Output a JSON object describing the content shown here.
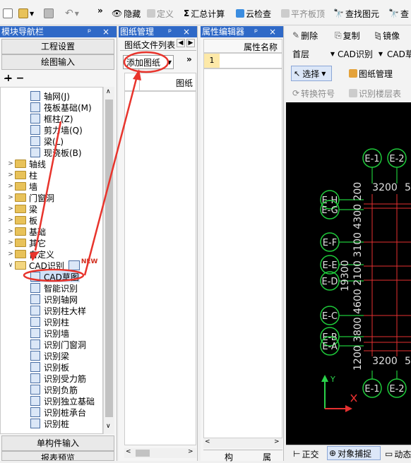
{
  "toolbar": {
    "more_glyph": "»",
    "hide": "隐藏",
    "define": "定义",
    "sum_glyph": "Σ",
    "sum": "汇总计算",
    "cloud_check": "云检查",
    "flush_slab": "平齐板顶",
    "find_element": "查找图元",
    "find_more": "查"
  },
  "module_nav": {
    "title": "模块导航栏",
    "controls": "ᵖ ×",
    "project_settings": "工程设置",
    "drawing_input": "绘图输入",
    "tree_top": [
      {
        "label": "轴网(J)",
        "icon": "grid-icon"
      },
      {
        "label": "筏板基础(M)",
        "icon": "raft-icon"
      },
      {
        "label": "框柱(Z)",
        "icon": "column-icon"
      },
      {
        "label": "剪力墙(Q)",
        "icon": "wall-icon"
      },
      {
        "label": "梁(L)",
        "icon": "beam-icon"
      },
      {
        "label": "现浇板(B)",
        "icon": "slab-icon"
      }
    ],
    "folders": [
      "轴线",
      "柱",
      "墙",
      "门窗洞",
      "梁",
      "板",
      "基础",
      "其它",
      "自定义"
    ],
    "cad_folder": "CAD识别",
    "new_badge": "NEW",
    "cad_items": [
      {
        "label": "CAD草图",
        "icon": "cad-sketch-icon"
      },
      {
        "label": "智能识别",
        "icon": "smart-recognize-icon"
      },
      {
        "label": "识别轴网",
        "icon": "recognize-grid-icon"
      },
      {
        "label": "识别柱大样",
        "icon": "recognize-column-detail-icon"
      },
      {
        "label": "识别柱",
        "icon": "recognize-column-icon"
      },
      {
        "label": "识别墙",
        "icon": "recognize-wall-icon"
      },
      {
        "label": "识别门窗洞",
        "icon": "recognize-opening-icon"
      },
      {
        "label": "识别梁",
        "icon": "recognize-beam-icon"
      },
      {
        "label": "识别板",
        "icon": "recognize-slab-icon"
      },
      {
        "label": "识别受力筋",
        "icon": "recognize-main-rebar-icon"
      },
      {
        "label": "识别负筋",
        "icon": "recognize-negative-rebar-icon"
      },
      {
        "label": "识别独立基础",
        "icon": "recognize-footing-icon"
      },
      {
        "label": "识别桩承台",
        "icon": "recognize-pile-cap-icon"
      },
      {
        "label": "识别桩",
        "icon": "recognize-pile-icon"
      }
    ],
    "single_component_input": "单构件输入",
    "report_preview": "报表预览"
  },
  "drawing_manager": {
    "title": "图纸管理",
    "controls": "ᵖ ×",
    "file_list_tab": "图纸文件列表",
    "add_drawing": "添加图纸",
    "more": "»",
    "column_drawing": "图纸",
    "bottom_tabs": [
      "构",
      "属"
    ]
  },
  "property_editor": {
    "title": "属性编辑器",
    "controls": "ᵖ ×",
    "column_name": "属性名称",
    "row_number": "1"
  },
  "right_toolbar": {
    "delete": "删除",
    "copy": "复制",
    "mirror": "镜像",
    "floor": "首层",
    "cad_recognize": "CAD识别",
    "cad_sketch_short": "CAD草",
    "select": "选择",
    "drawing_management": "图纸管理",
    "convert_symbol": "转换符号",
    "recognize_floor_table": "识别楼层表"
  },
  "canvas": {
    "top_axes": [
      "E-1",
      "E-2"
    ],
    "bottom_axes": [
      "E-1",
      "E-2"
    ],
    "left_axes": [
      "E-H",
      "E-G",
      "E-F",
      "E-E",
      "E-D",
      "E-C",
      "E-B",
      "E-A"
    ],
    "dim_top": "3200",
    "dim_top2": "5",
    "dim_bottom": "3200",
    "dim_bottom2": "5",
    "vertical_dims": "1200 3800 4600 2100 3100 4300 200",
    "total_dim": "19300",
    "ucs_y": "Y",
    "colors": {
      "axis": "#1ec93a",
      "grid": "#e63030",
      "dim": "#e0e0e0",
      "ucs_y": "#2ad24a",
      "ucs_x": "#e63030"
    }
  },
  "status_bar": {
    "ortho": "正交",
    "object_snap": "对象捕捉",
    "dynamic": "动态"
  }
}
